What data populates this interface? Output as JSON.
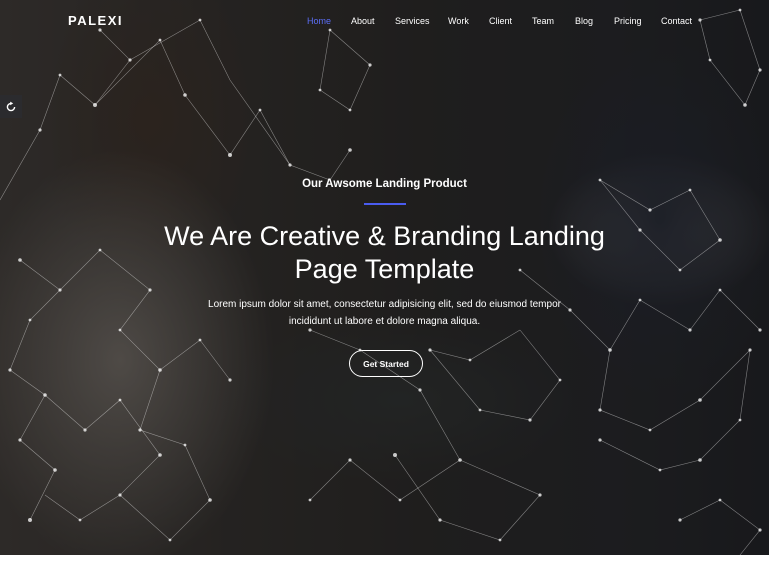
{
  "brand": {
    "logo_text": "PALEXI"
  },
  "nav": {
    "items": [
      {
        "label": "Home",
        "active": true
      },
      {
        "label": "About",
        "active": false
      },
      {
        "label": "Services",
        "active": false
      },
      {
        "label": "Work",
        "active": false
      },
      {
        "label": "Client",
        "active": false
      },
      {
        "label": "Team",
        "active": false
      },
      {
        "label": "Blog",
        "active": false
      },
      {
        "label": "Pricing",
        "active": false
      },
      {
        "label": "Contact",
        "active": false
      }
    ]
  },
  "hero": {
    "subtitle": "Our Awsome Landing Product",
    "headline_line1": "We Are Creative & Branding Landing",
    "headline_line2": "Page Template",
    "description_line1": "Lorem ipsum dolor sit amet, consectetur adipisicing elit, sed do eiusmod tempor",
    "description_line2": "incididunt ut labore et dolore magna aliqua.",
    "cta_label": "Get Started"
  },
  "side_widget": {
    "icon": "refresh-icon"
  },
  "colors": {
    "accent": "#4a5cf0",
    "active_nav": "#5b6df5",
    "text": "#ffffff",
    "overlay": "#0a0a0c"
  }
}
